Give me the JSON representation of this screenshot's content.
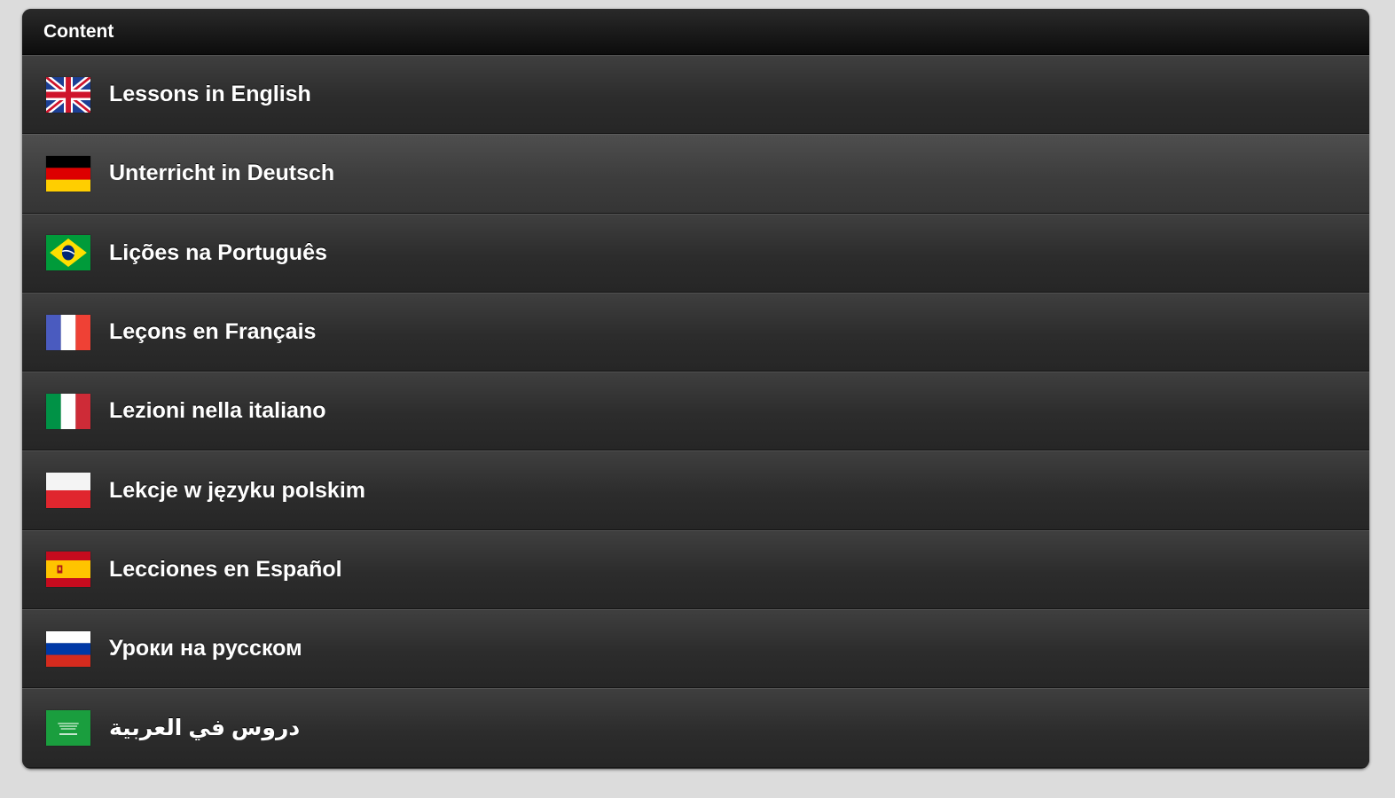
{
  "header": {
    "title": "Content"
  },
  "items": [
    {
      "label": "Lessons in English",
      "flag_icon": "uk-flag-icon"
    },
    {
      "label": "Unterricht in Deutsch",
      "flag_icon": "germany-flag-icon"
    },
    {
      "label": "Lições na Português",
      "flag_icon": "brazil-flag-icon"
    },
    {
      "label": "Leçons en Français",
      "flag_icon": "france-flag-icon"
    },
    {
      "label": "Lezioni nella italiano",
      "flag_icon": "italy-flag-icon"
    },
    {
      "label": "Lekcje w języku polskim",
      "flag_icon": "poland-flag-icon"
    },
    {
      "label": "Lecciones en Español",
      "flag_icon": "spain-flag-icon"
    },
    {
      "label": "Уроки на русском",
      "flag_icon": "russia-flag-icon"
    },
    {
      "label": "دروس في العربية",
      "flag_icon": "saudi-arabia-flag-icon"
    }
  ],
  "colors": {
    "page_background": "#dcdcdc",
    "panel_background": "#2b2b2b",
    "header_background": "#111111",
    "text": "#ffffff"
  }
}
